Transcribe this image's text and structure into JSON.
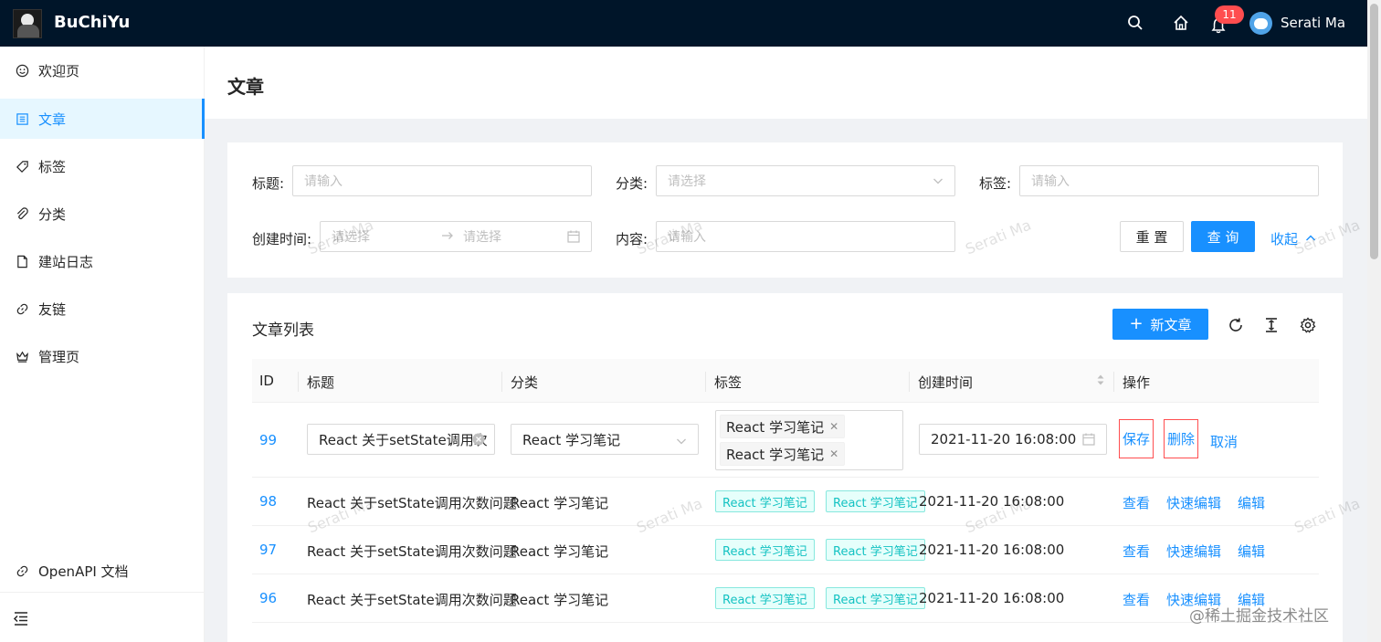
{
  "header": {
    "brand": "BuChiYu",
    "notification_count": "11",
    "user_name": "Serati Ma",
    "icons": [
      "search-icon",
      "home-icon",
      "bell-icon"
    ]
  },
  "sidebar": {
    "items": [
      {
        "label": "欢迎页",
        "icon": "smile-icon"
      },
      {
        "label": "文章",
        "icon": "article-icon",
        "active": true
      },
      {
        "label": "标签",
        "icon": "tag-icon"
      },
      {
        "label": "分类",
        "icon": "paperclip-icon"
      },
      {
        "label": "建站日志",
        "icon": "file-icon"
      },
      {
        "label": "友链",
        "icon": "link-icon"
      },
      {
        "label": "管理页",
        "icon": "crown-icon"
      }
    ],
    "bottom_link": "OpenAPI 文档",
    "collapse_icon": "menu-fold-icon"
  },
  "page": {
    "title": "文章"
  },
  "search": {
    "title_label": "标题:",
    "title_placeholder": "请输入",
    "category_label": "分类:",
    "category_placeholder": "请选择",
    "tags_label": "标签:",
    "tags_placeholder": "请输入",
    "created_label": "创建时间:",
    "created_start_placeholder": "请选择",
    "created_end_placeholder": "请选择",
    "content_label": "内容:",
    "content_placeholder": "请输入",
    "reset_button": "重 置",
    "query_button": "查 询",
    "collapse_link": "收起"
  },
  "table": {
    "title": "文章列表",
    "new_button": "新文章",
    "toolbar_icons": [
      "reload-icon",
      "column-height-icon",
      "setting-icon"
    ],
    "columns": [
      "ID",
      "标题",
      "分类",
      "标签",
      "创建时间",
      "操作"
    ],
    "editing_row": {
      "id": "99",
      "title_value": "React 关于setState调用次",
      "category_value": "React 学习笔记",
      "tags": [
        "React 学习笔记",
        "React 学习笔记"
      ],
      "created": "2021-11-20 16:08:00",
      "actions": [
        "保存",
        "删除",
        "取消"
      ]
    },
    "rows": [
      {
        "id": "98",
        "title": "React 关于setState调用次数问题",
        "category": "React 学习笔记",
        "tags": [
          "React 学习笔记",
          "React 学习笔记"
        ],
        "created": "2021-11-20 16:08:00",
        "actions": [
          "查看",
          "快速编辑",
          "编辑"
        ]
      },
      {
        "id": "97",
        "title": "React 关于setState调用次数问题",
        "category": "React 学习笔记",
        "tags": [
          "React 学习笔记",
          "React 学习笔记"
        ],
        "created": "2021-11-20 16:08:00",
        "actions": [
          "查看",
          "快速编辑",
          "编辑"
        ]
      },
      {
        "id": "96",
        "title": "React 关于setState调用次数问题",
        "category": "React 学习笔记",
        "tags": [
          "React 学习笔记",
          "React 学习笔记"
        ],
        "created": "2021-11-20 16:08:00",
        "actions": [
          "查看",
          "快速编辑",
          "编辑"
        ]
      }
    ]
  },
  "watermark": "Serati Ma",
  "credit": "@稀土掘金技术社区"
}
